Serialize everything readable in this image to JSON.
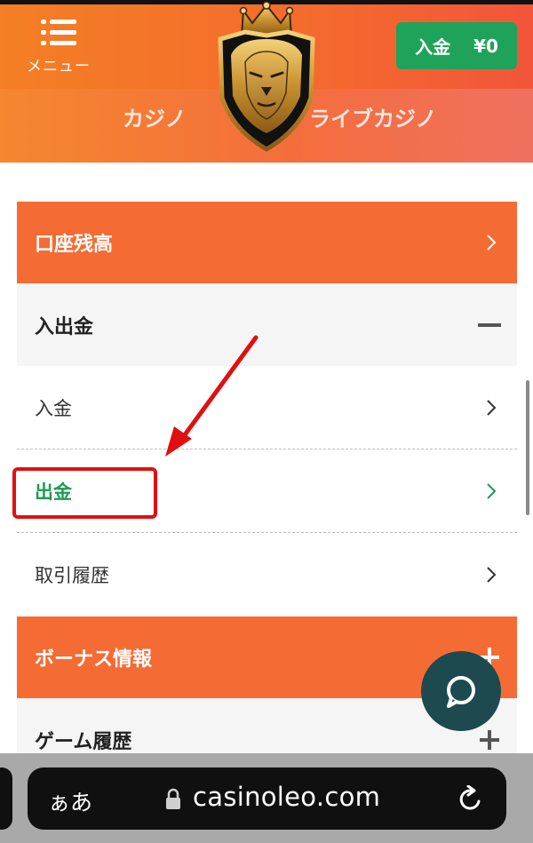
{
  "header": {
    "menu_label": "メニュー",
    "deposit_label": "入金",
    "balance": "¥0",
    "nav": [
      "カジノ",
      "ライブカジノ"
    ]
  },
  "menu": {
    "account_balance": "口座残高",
    "deposit_withdrawal": "入出金",
    "sub_items": [
      "入金",
      "出金",
      "取引履歴"
    ],
    "bonus_info": "ボーナス情報",
    "game_history": "ゲーム履歴"
  },
  "browser": {
    "aa_label": "ぁあ",
    "url": "casinoleo.com"
  },
  "colors": {
    "header_orange": "#f46a2e",
    "row_orange": "#f46c34",
    "deposit_green": "#1fa35a",
    "active_green": "#1e9a55",
    "annotation_red": "#e01010",
    "chat_teal": "#1d4a4f"
  },
  "icons": {
    "menu": "hamburger-menu-icon",
    "chat": "chat-bubble-icon",
    "lock": "lock-icon",
    "reload": "reload-icon",
    "chevron": "chevron-right-icon",
    "plus": "plus-icon",
    "minus": "minus-icon"
  }
}
